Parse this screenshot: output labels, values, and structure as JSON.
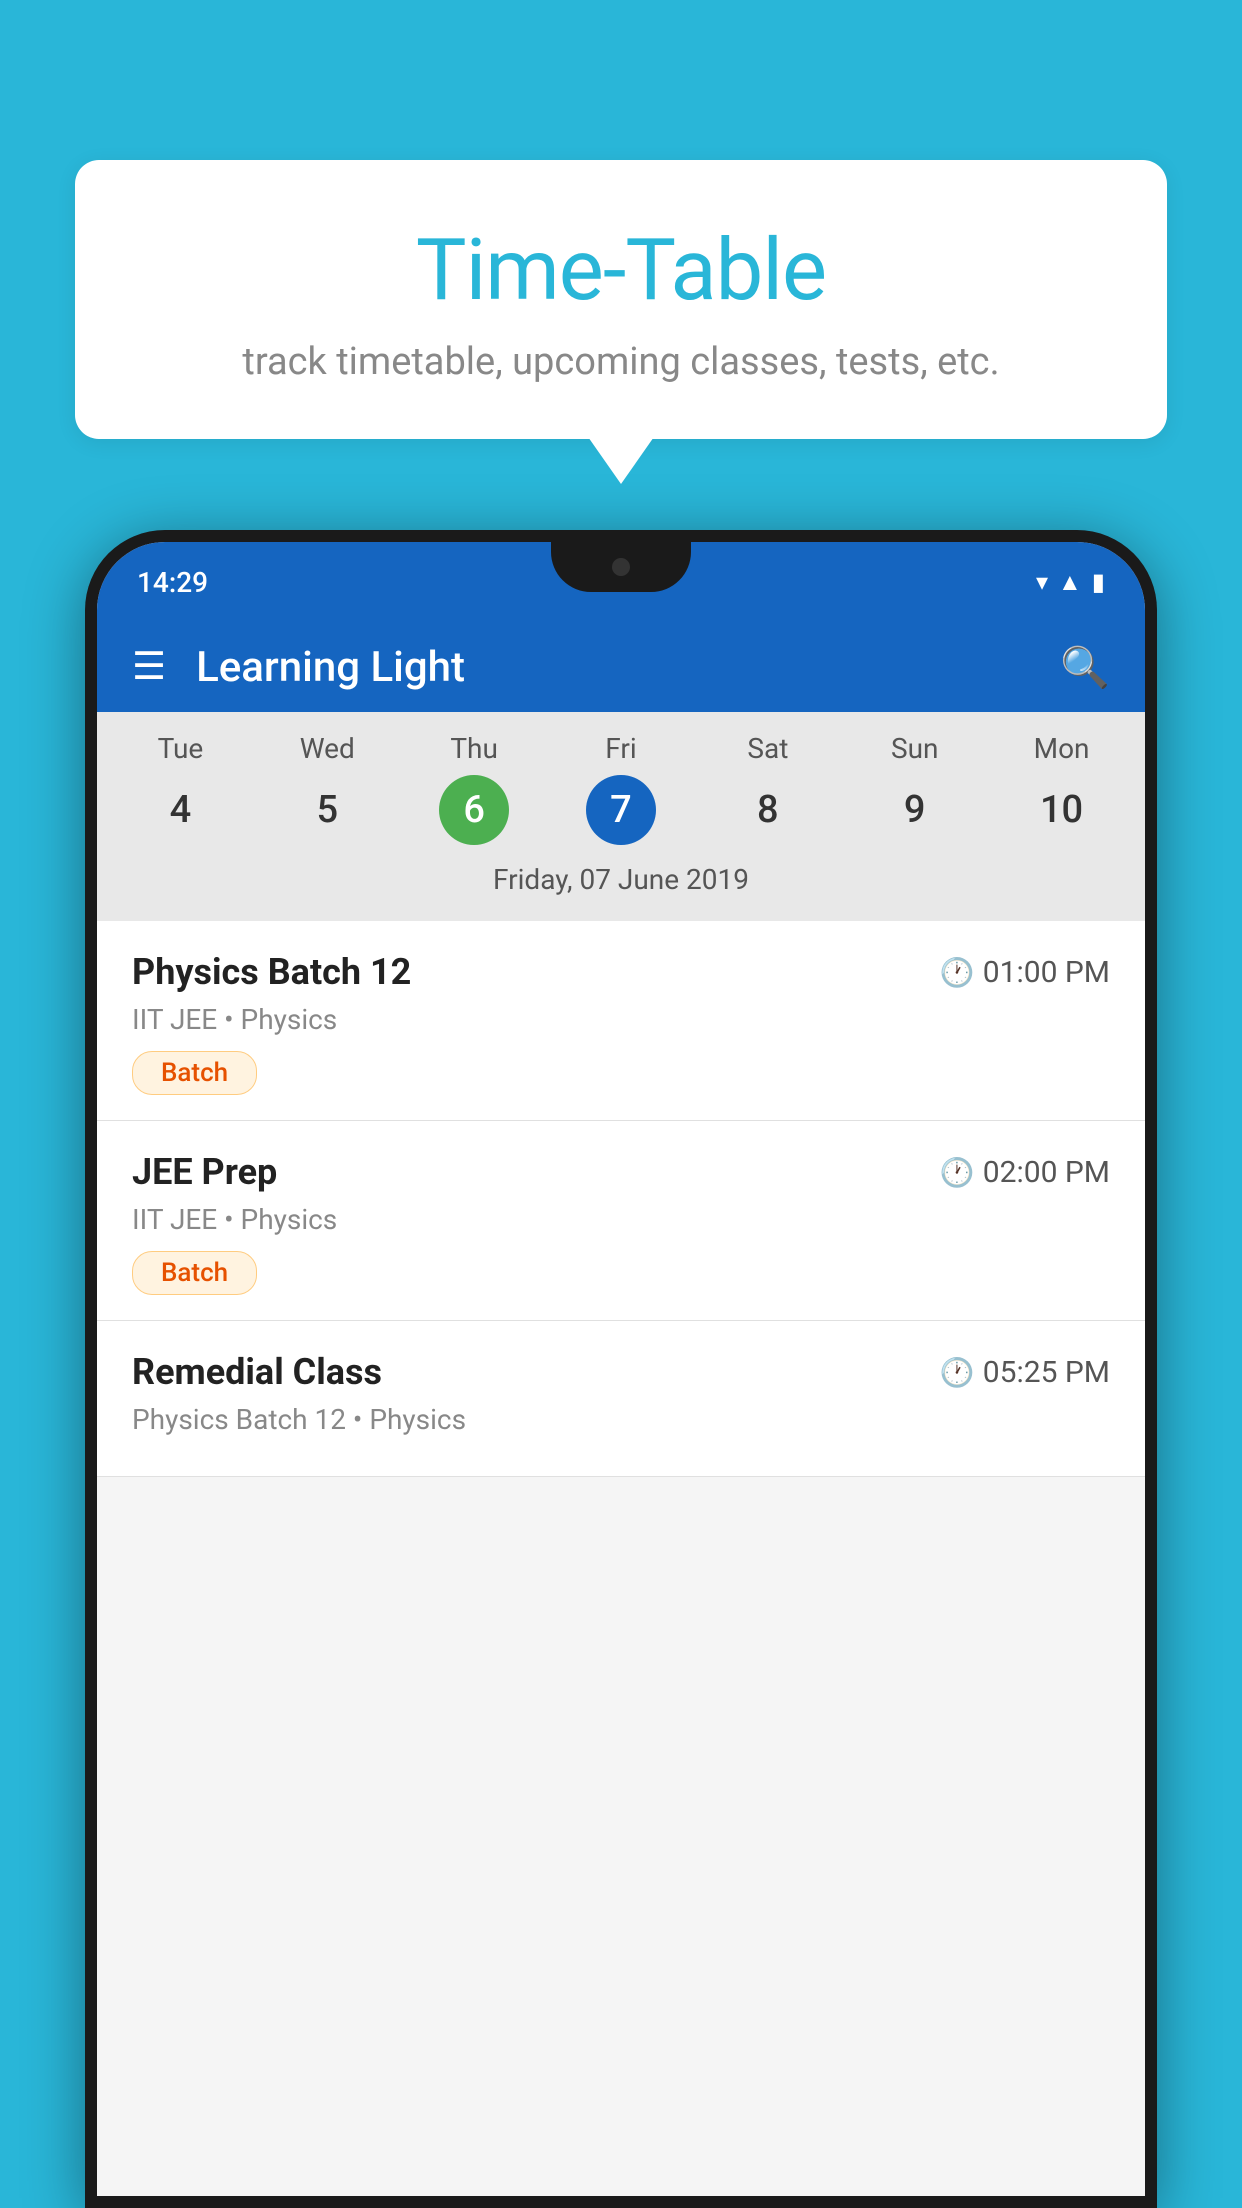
{
  "background_color": "#29B6D8",
  "bubble": {
    "title": "Time-Table",
    "subtitle": "track timetable, upcoming classes, tests, etc."
  },
  "status_bar": {
    "time": "14:29",
    "icons": [
      "wifi",
      "signal",
      "battery"
    ]
  },
  "app_header": {
    "title": "Learning Light"
  },
  "calendar": {
    "days": [
      {
        "name": "Tue",
        "number": "4",
        "state": "normal"
      },
      {
        "name": "Wed",
        "number": "5",
        "state": "normal"
      },
      {
        "name": "Thu",
        "number": "6",
        "state": "today"
      },
      {
        "name": "Fri",
        "number": "7",
        "state": "selected"
      },
      {
        "name": "Sat",
        "number": "8",
        "state": "normal"
      },
      {
        "name": "Sun",
        "number": "9",
        "state": "normal"
      },
      {
        "name": "Mon",
        "number": "10",
        "state": "normal"
      }
    ],
    "selected_date_label": "Friday, 07 June 2019"
  },
  "schedule_items": [
    {
      "title": "Physics Batch 12",
      "time": "01:00 PM",
      "subtitle": "IIT JEE • Physics",
      "badge": "Batch"
    },
    {
      "title": "JEE Prep",
      "time": "02:00 PM",
      "subtitle": "IIT JEE • Physics",
      "badge": "Batch"
    },
    {
      "title": "Remedial Class",
      "time": "05:25 PM",
      "subtitle": "Physics Batch 12 • Physics",
      "badge": null
    }
  ]
}
